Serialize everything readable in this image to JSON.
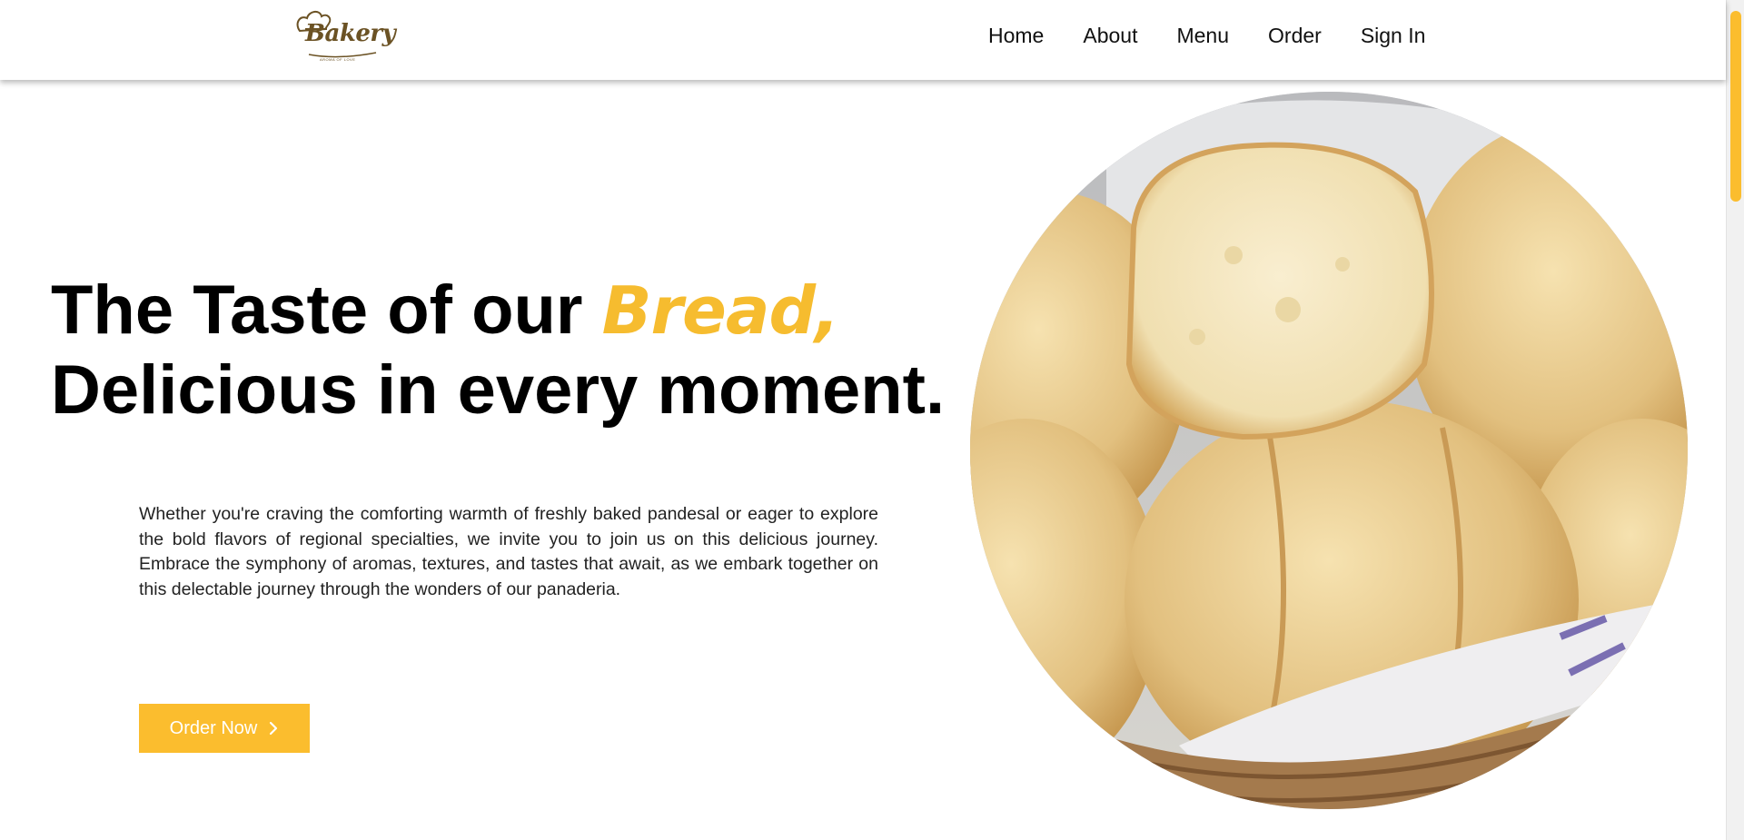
{
  "brand": {
    "logo_text": "Bakery",
    "logo_tagline": "AROMA OF LOVE"
  },
  "nav": {
    "items": [
      {
        "label": "Home"
      },
      {
        "label": "About"
      },
      {
        "label": "Menu"
      },
      {
        "label": "Order"
      },
      {
        "label": "Sign In"
      }
    ]
  },
  "hero": {
    "headline_part1": "The Taste of our ",
    "headline_highlight": "Bread,",
    "headline_line2": "Delicious in every moment.",
    "description": "Whether you're craving the comforting warmth of freshly baked pandesal or eager to explore the bold flavors of regional specialties, we invite you to join us on this delicious journey. Embrace the symphony of aromas, textures, and tastes that await, as we embark together on this delectable journey through the wonders of our panaderia.",
    "cta_label": "Order Now",
    "cta_icon": "chevron-right-icon",
    "image_label": "basket of bread rolls"
  },
  "colors": {
    "accent": "#fbbd2e",
    "text": "#111111",
    "brand_brown": "#6b5224"
  }
}
